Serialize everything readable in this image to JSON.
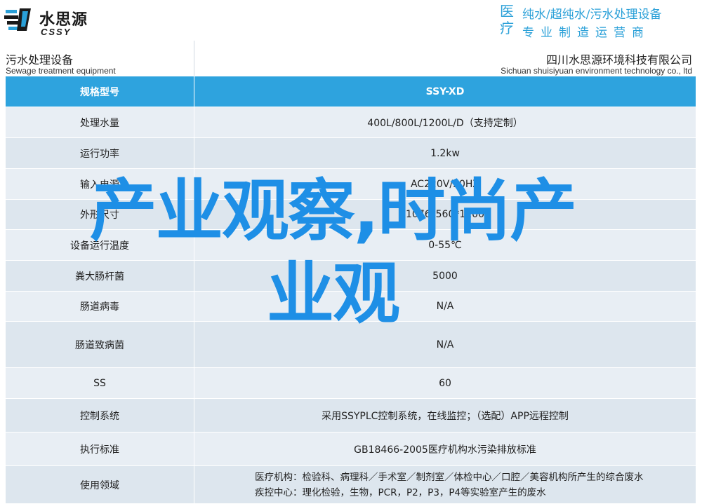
{
  "header": {
    "logo_cn": "水思源",
    "logo_en": "CSSY",
    "tag_big": "医疗",
    "tag_line1": "纯水/超纯水/污水处理设备",
    "tag_line2": "专业制造运营商"
  },
  "subheader": {
    "left_cn": "污水处理设备",
    "left_en": "Sewage treatment equipment",
    "right_cn": "四川水思源环境科技有限公司",
    "right_en": "Sichuan shuisiyuan environment technology co., ltd"
  },
  "table": {
    "header": {
      "label": "规格型号",
      "value": "SSY-XD"
    },
    "rows": [
      {
        "label": "处理水量",
        "value": "400L/800L/1200L/D（支持定制）"
      },
      {
        "label": "运行功率",
        "value": "1.2kw"
      },
      {
        "label": "输入电源",
        "value": "AC220V/50HZ"
      },
      {
        "label": "外形尺寸",
        "value": "1076*560*1100"
      },
      {
        "label": "设备运行温度",
        "value": "0-55℃"
      },
      {
        "label": "粪大肠杆菌",
        "value": "5000"
      },
      {
        "label": "肠道病毒",
        "value": "N/A"
      },
      {
        "label": "肠道致病菌",
        "value": "N/A"
      },
      {
        "label": "SS",
        "value": "60"
      },
      {
        "label": "控制系统",
        "value": "采用SSYPLC控制系统，在线监控；（选配）APP远程控制"
      },
      {
        "label": "执行标准",
        "value": "GB18466-2005医疗机构水污染排放标准"
      },
      {
        "label": "使用领域",
        "value_line1": "医疗机构：检验科、病理科／手术室／制剂室／体检中心／口腔／美容机构所产生的综合废水",
        "value_line2": "疾控中心：理化检验，生物，PCR，P2，P3，P4等实验室产生的废水"
      }
    ]
  },
  "watermark": {
    "line1": "产业观察,时尚产",
    "line2": "业观"
  },
  "colors": {
    "accent": "#2ea3de",
    "watermark": "#1e8fe6",
    "row_light": "#e8eef4",
    "row_dark": "#dde6ee"
  }
}
